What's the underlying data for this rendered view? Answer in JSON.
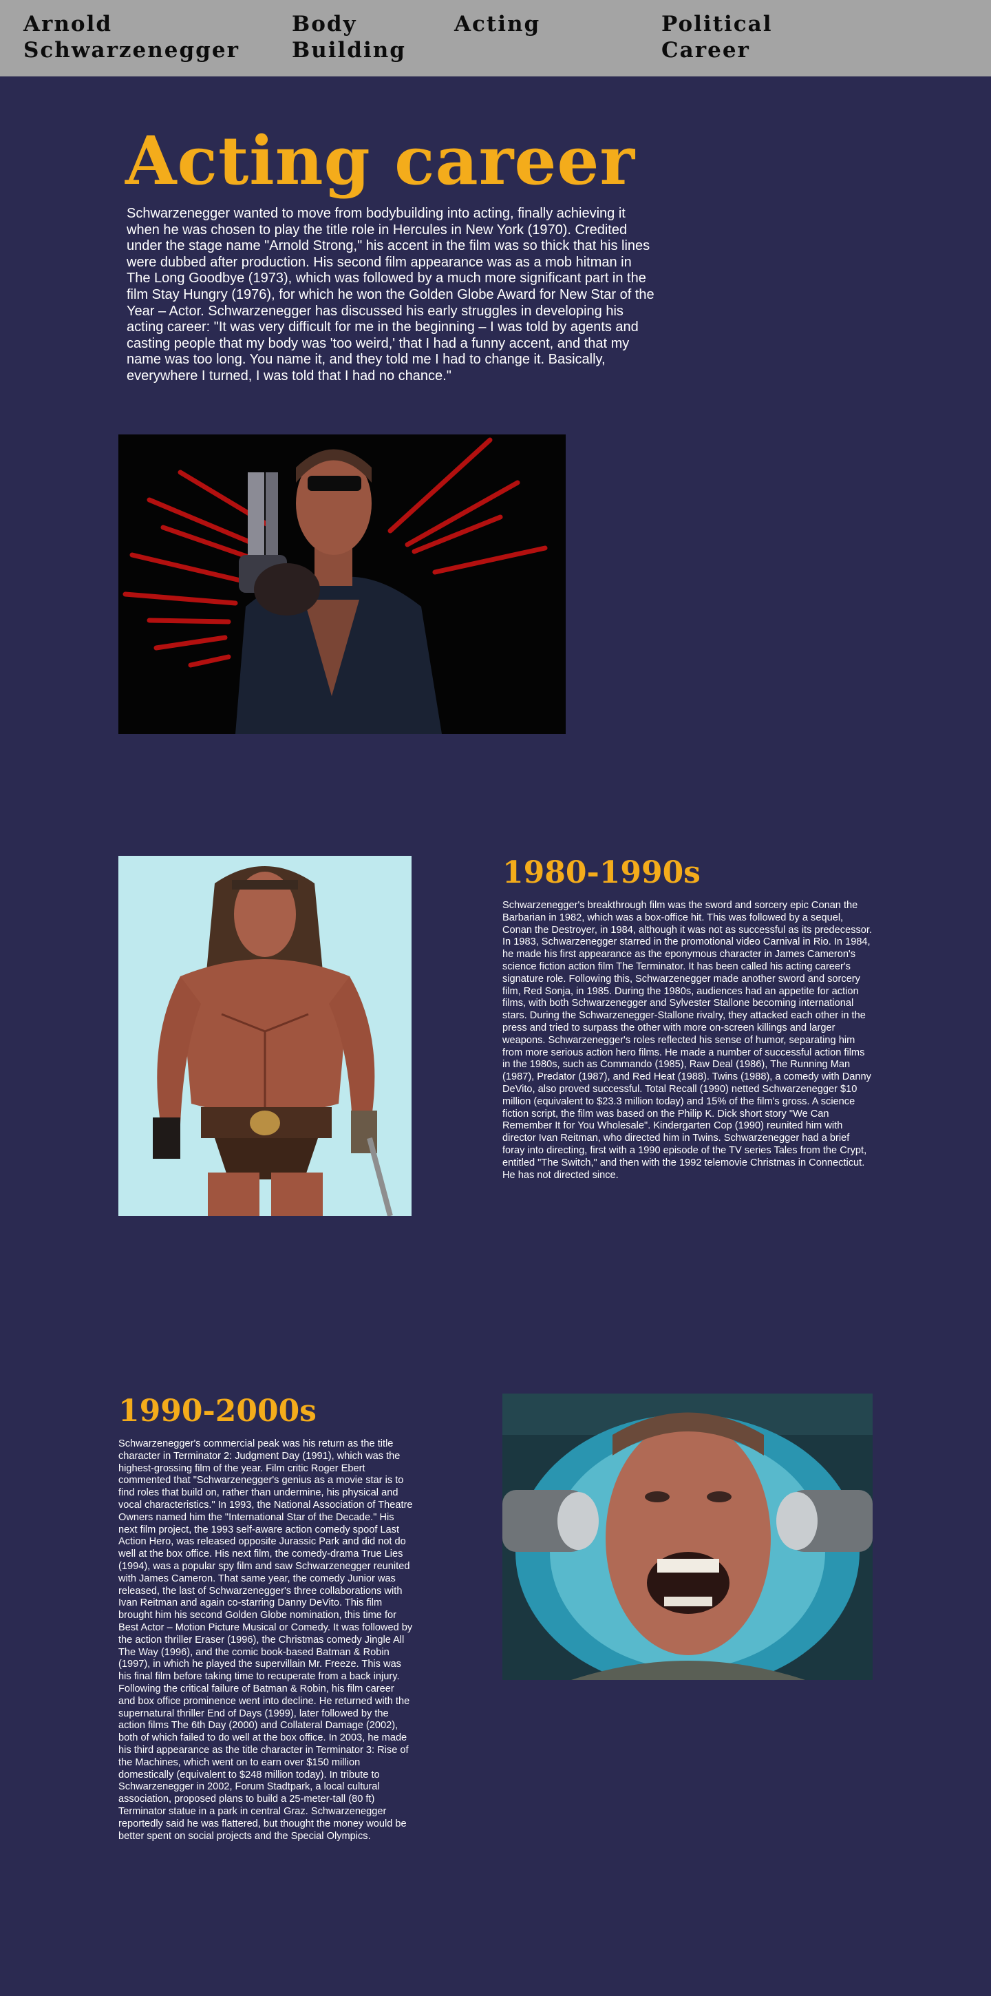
{
  "nav": {
    "items": [
      {
        "label": "Arnold Schwarzenegger"
      },
      {
        "label": "Body Building"
      },
      {
        "label": "Acting"
      },
      {
        "label": "Political Career"
      }
    ]
  },
  "hero": {
    "title": "Acting career",
    "text": "Schwarzenegger wanted to move from bodybuilding into acting, finally achieving it when he was chosen to play the title role in Hercules in New York (1970). Credited under the stage name \"Arnold Strong,\" his accent in the film was so thick that his lines were dubbed after production. His second film appearance was as a mob hitman in The Long Goodbye (1973), which was followed by a much more significant part in the film Stay Hungry (1976), for which he won the Golden Globe Award for New Star of the Year – Actor. Schwarzenegger has discussed his early struggles in developing his acting career: \"It was very difficult for me in the beginning – I was told by agents and casting people that my body was 'too weird,' that I had a funny accent, and that my name was too long. You name it, and they told me I had to change it. Basically, everywhere I turned, I was told that I had no chance.\""
  },
  "section_1980": {
    "title": "1980-1990s",
    "text": "Schwarzenegger's breakthrough film was the sword and sorcery epic Conan the Barbarian in 1982, which was a box-office hit. This was followed by a sequel, Conan the Destroyer, in 1984, although it was not as successful as its predecessor. In 1983, Schwarzenegger starred in the promotional video Carnival in Rio. In 1984, he made his first appearance as the eponymous character in James Cameron's science fiction action film The Terminator. It has been called his acting career's signature role. Following this, Schwarzenegger made another sword and sorcery film, Red Sonja, in 1985. During the 1980s, audiences had an appetite for action films, with both Schwarzenegger and Sylvester Stallone becoming international stars. During the Schwarzenegger-Stallone rivalry, they attacked each other in the press and tried to surpass the other with more on-screen killings and larger weapons. Schwarzenegger's roles reflected his sense of humor, separating him from more serious action hero films. He made a number of successful action films in the 1980s, such as Commando (1985), Raw Deal (1986), The Running Man (1987), Predator (1987), and Red Heat (1988). Twins (1988), a comedy with Danny DeVito, also proved successful. Total Recall (1990) netted Schwarzenegger $10 million (equivalent to $23.3 million today) and 15% of the film's gross. A science fiction script, the film was based on the Philip K. Dick short story \"We Can Remember It for You Wholesale\". Kindergarten Cop (1990) reunited him with director Ivan Reitman, who directed him in Twins. Schwarzenegger had a brief foray into directing, first with a 1990 episode of the TV series Tales from the Crypt, entitled \"The Switch,\" and then with the 1992 telemovie Christmas in Connecticut. He has not directed since."
  },
  "section_1990": {
    "title": "1990-2000s",
    "text": "Schwarzenegger's commercial peak was his return as the title character in Terminator 2: Judgment Day (1991), which was the highest-grossing film of the year. Film critic Roger Ebert commented that \"Schwarzenegger's genius as a movie star is to find roles that build on, rather than undermine, his physical and vocal characteristics.\" In 1993, the National Association of Theatre Owners named him the \"International Star of the Decade.\" His next film project, the 1993 self-aware action comedy spoof Last Action Hero, was released opposite Jurassic Park and did not do well at the box office. His next film, the comedy-drama True Lies (1994), was a popular spy film and saw Schwarzenegger reunited with James Cameron. That same year, the comedy Junior was released, the last of Schwarzenegger's three collaborations with Ivan Reitman and again co-starring Danny DeVito. This film brought him his second Golden Globe nomination, this time for Best Actor – Motion Picture Musical or Comedy. It was followed by the action thriller Eraser (1996), the Christmas comedy Jingle All The Way (1996), and the comic book-based Batman & Robin (1997), in which he played the supervillain Mr. Freeze. This was his final film before taking time to recuperate from a back injury. Following the critical failure of Batman & Robin, his film career and box office prominence went into decline. He returned with the supernatural thriller End of Days (1999), later followed by the action films The 6th Day (2000) and Collateral Damage (2002), both of which failed to do well at the box office. In 2003, he made his third appearance as the title character in Terminator 3: Rise of the Machines, which went on to earn over $150 million domestically (equivalent to $248 million today). In tribute to Schwarzenegger in 2002, Forum Stadtpark, a local cultural association, proposed plans to build a 25-meter-tall (80 ft) Terminator statue in a park in central Graz. Schwarzenegger reportedly said he was flattered, but thought the money would be better spent on social projects and the Special Olympics."
  },
  "colors": {
    "background": "#2b2a51",
    "nav_background": "#a4a4a4",
    "accent": "#f4ac1b",
    "text": "#ffffff"
  }
}
